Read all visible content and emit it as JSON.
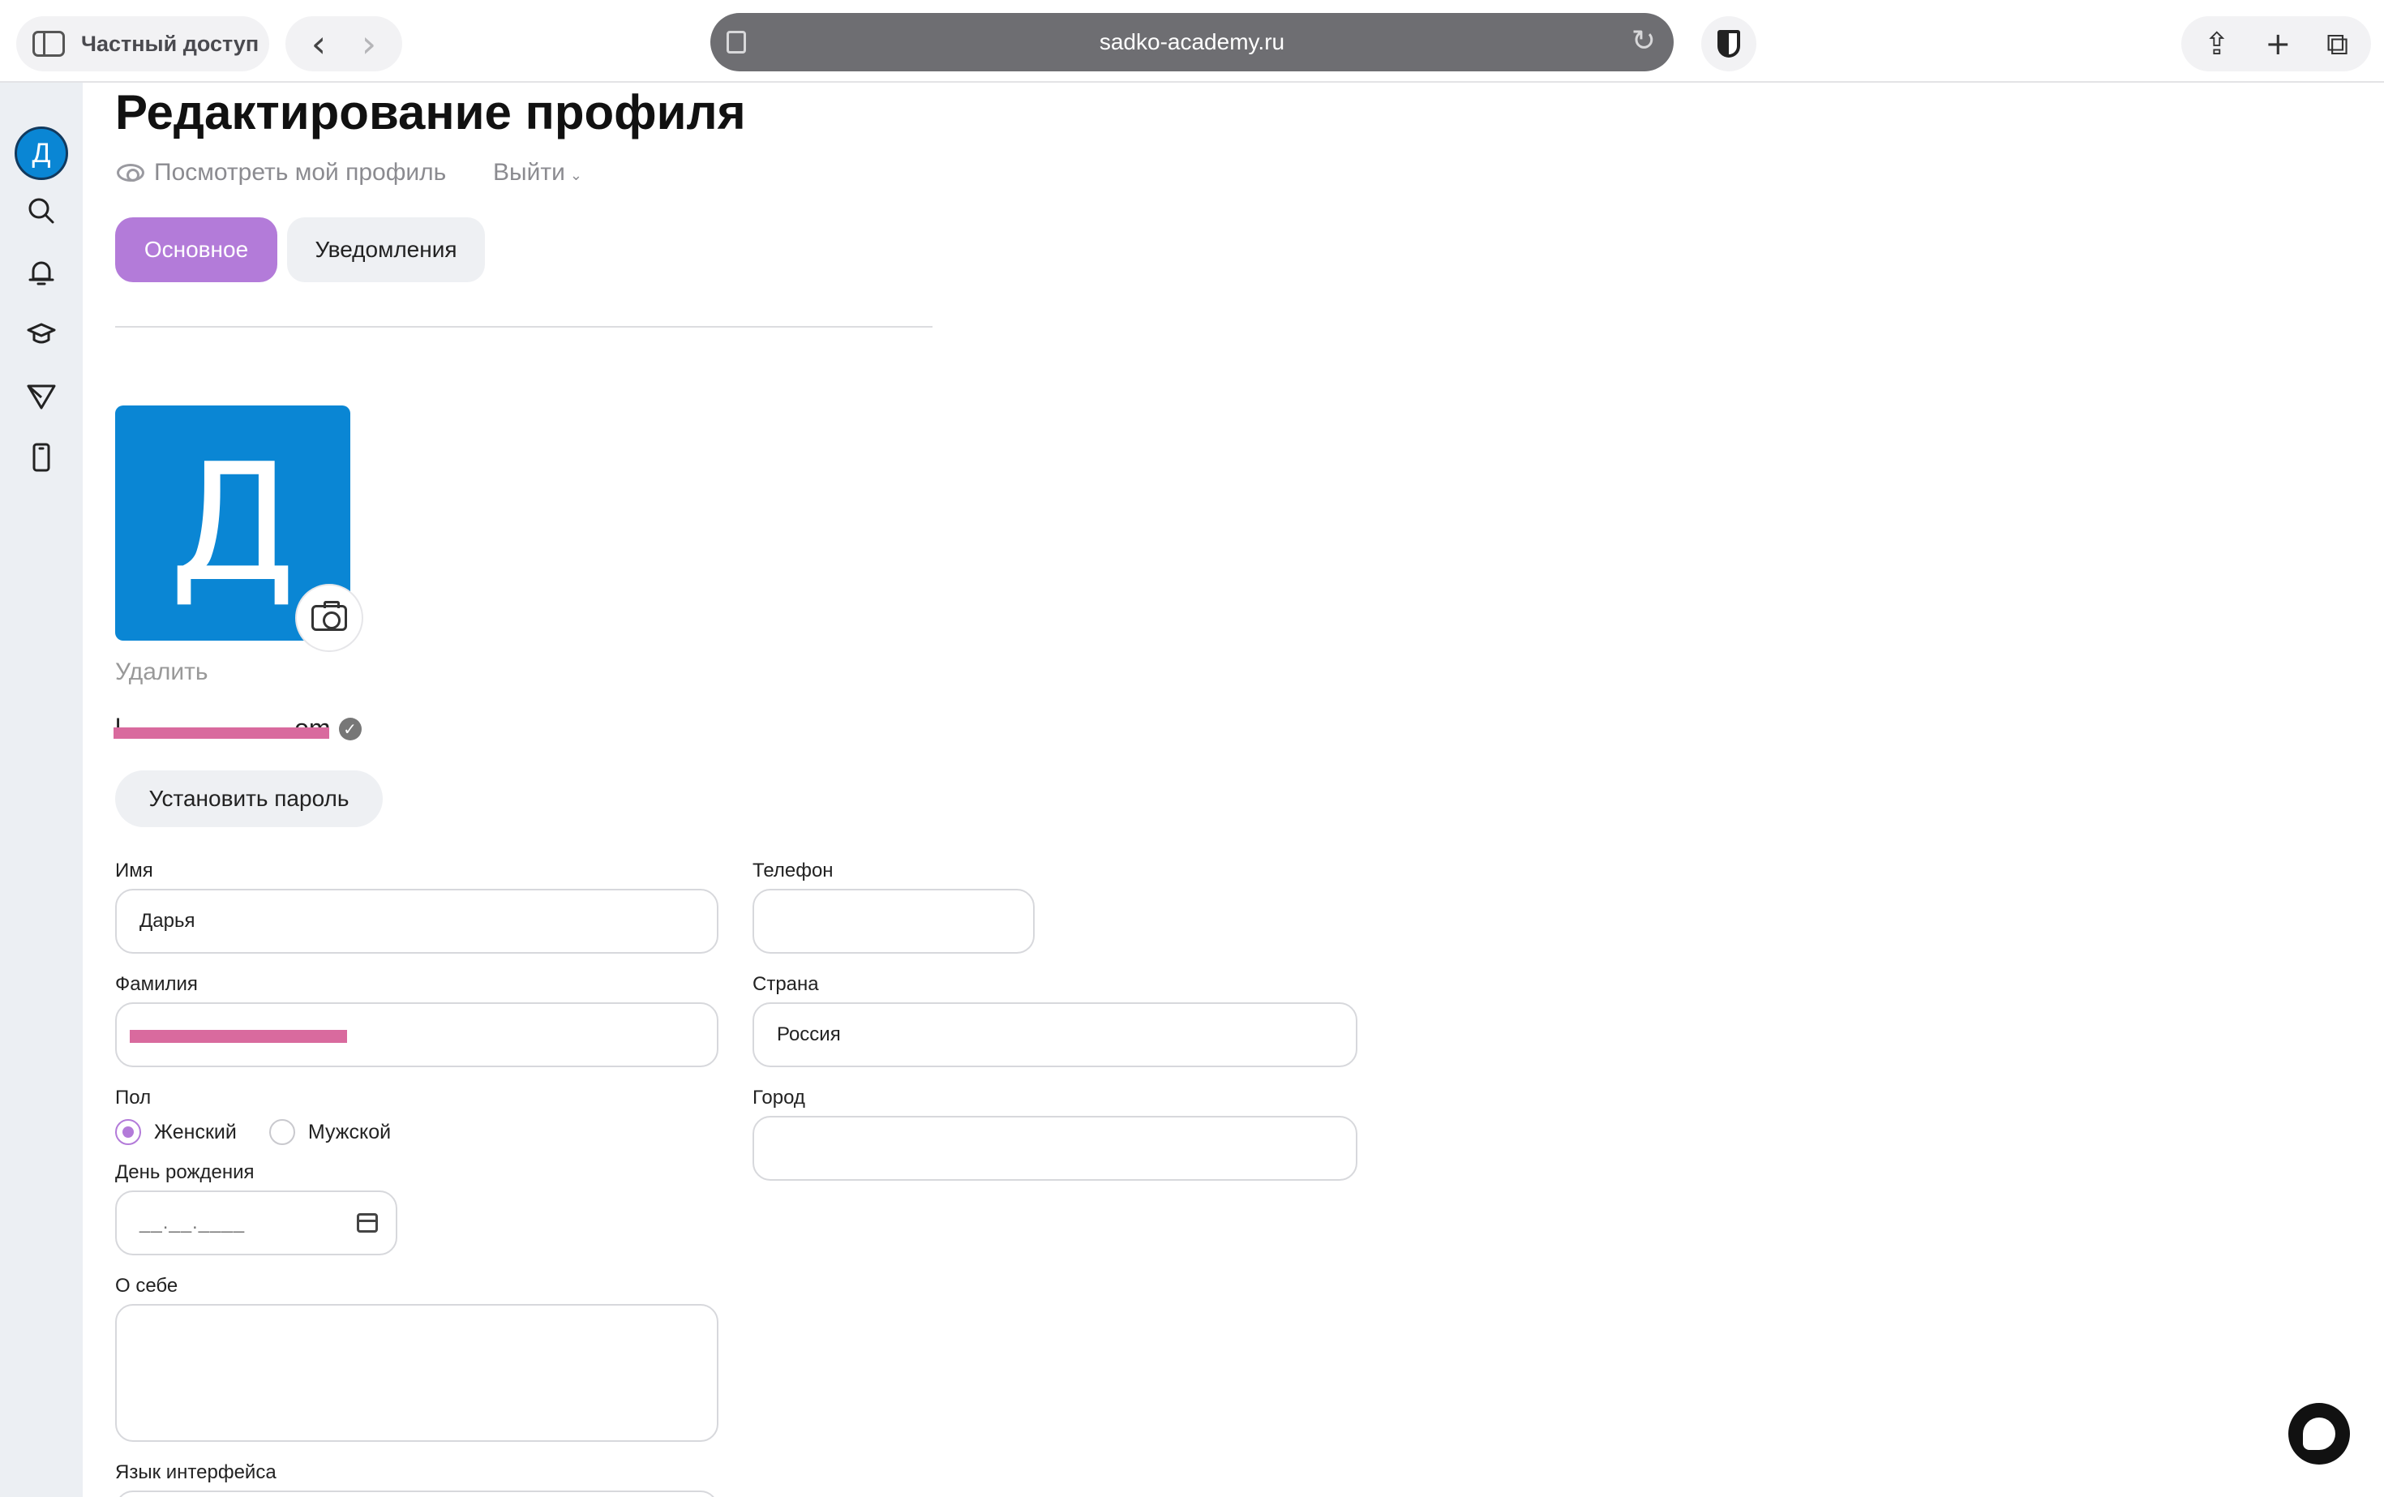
{
  "browser": {
    "private_label": "Частный доступ",
    "url": "sadko-academy.ru"
  },
  "rail": {
    "avatar_letter": "Д",
    "icons": [
      "search-icon",
      "bell-icon",
      "graduation-cap-icon",
      "send-icon",
      "phone-icon"
    ]
  },
  "page": {
    "title": "Редактирование профиля",
    "view_profile": "Посмотреть мой профиль",
    "logout": "Выйти"
  },
  "tabs": [
    {
      "label": "Основное",
      "active": true
    },
    {
      "label": "Уведомления",
      "active": false
    }
  ],
  "avatar": {
    "letter": "Д",
    "color": "#0a86d4",
    "delete_label": "Удалить"
  },
  "account": {
    "email_visible_suffix": "om",
    "email_visible_prefix": "l",
    "set_password_label": "Установить пароль"
  },
  "form": {
    "first_name": {
      "label": "Имя",
      "value": "Дарья"
    },
    "last_name": {
      "label": "Фамилия",
      "value": ""
    },
    "phone": {
      "label": "Телефон",
      "value": ""
    },
    "country": {
      "label": "Страна",
      "value": "Россия"
    },
    "city": {
      "label": "Город",
      "value": ""
    },
    "gender": {
      "label": "Пол",
      "options": [
        "Женский",
        "Мужской"
      ],
      "selected": "Женский"
    },
    "birthday": {
      "label": "День рождения",
      "mask": "__.__.____"
    },
    "about": {
      "label": "О себе",
      "value": ""
    },
    "language": {
      "label": "Язык интерфейса"
    }
  },
  "colors": {
    "accent": "#b37bd9",
    "avatar_bg": "#0a86d4",
    "redaction": "#d96a9e"
  }
}
